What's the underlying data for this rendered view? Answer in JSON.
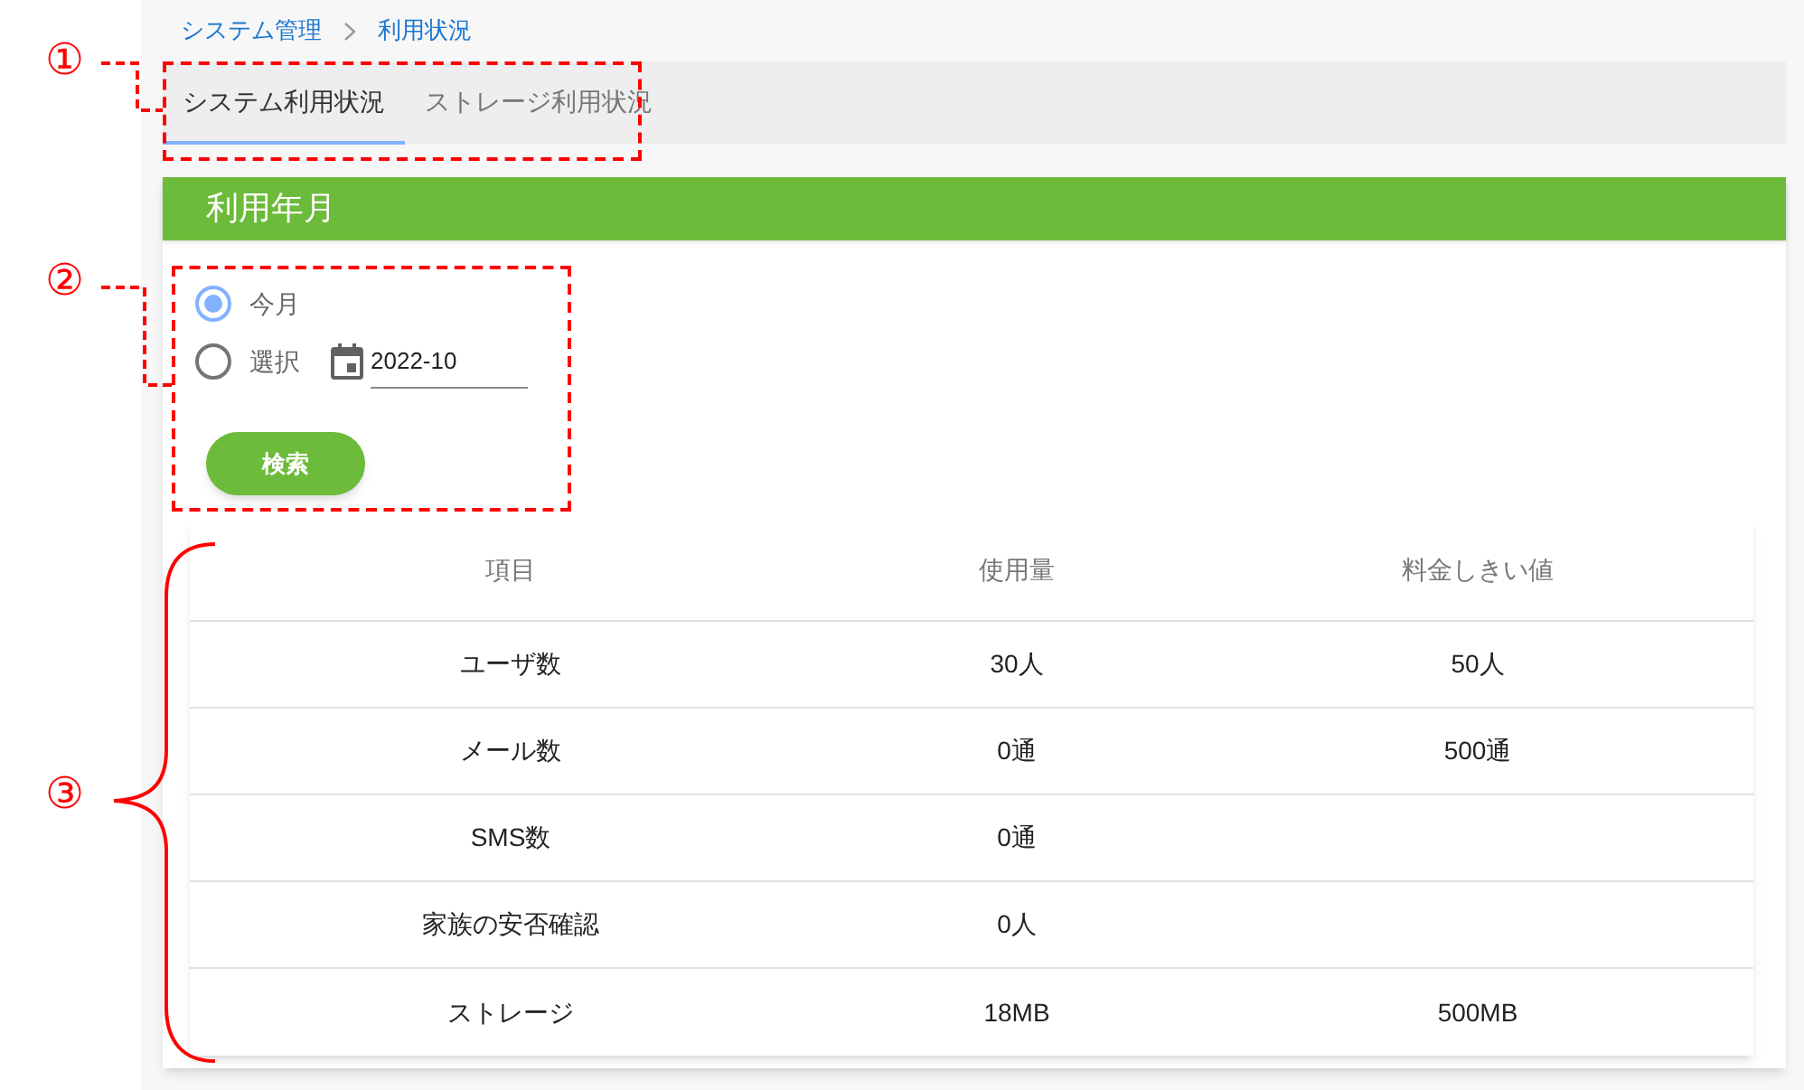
{
  "breadcrumb": [
    {
      "label": "システム管理"
    },
    {
      "label": "利用状況"
    }
  ],
  "tabs": [
    {
      "label": "システム利用状況",
      "selected": true
    },
    {
      "label": "ストレージ利用状況",
      "selected": false
    }
  ],
  "section": {
    "title": "利用年月",
    "radios": [
      {
        "label": "今月",
        "selected": true
      },
      {
        "label": "選択",
        "selected": false
      }
    ],
    "month_field": {
      "value": "2022-10"
    },
    "search_button": "検索"
  },
  "table": {
    "columns": [
      "項目",
      "使用量",
      "料金しきい値"
    ],
    "rows": [
      [
        "ユーザ数",
        "30人",
        "50人"
      ],
      [
        "メール数",
        "0通",
        "500通"
      ],
      [
        "SMS数",
        "0通",
        ""
      ],
      [
        "家族の安否確認",
        "0人",
        ""
      ],
      [
        "ストレージ",
        "18MB",
        "500MB"
      ]
    ]
  },
  "annotations": [
    {
      "label": "①"
    },
    {
      "label": "②"
    },
    {
      "label": "③"
    }
  ]
}
